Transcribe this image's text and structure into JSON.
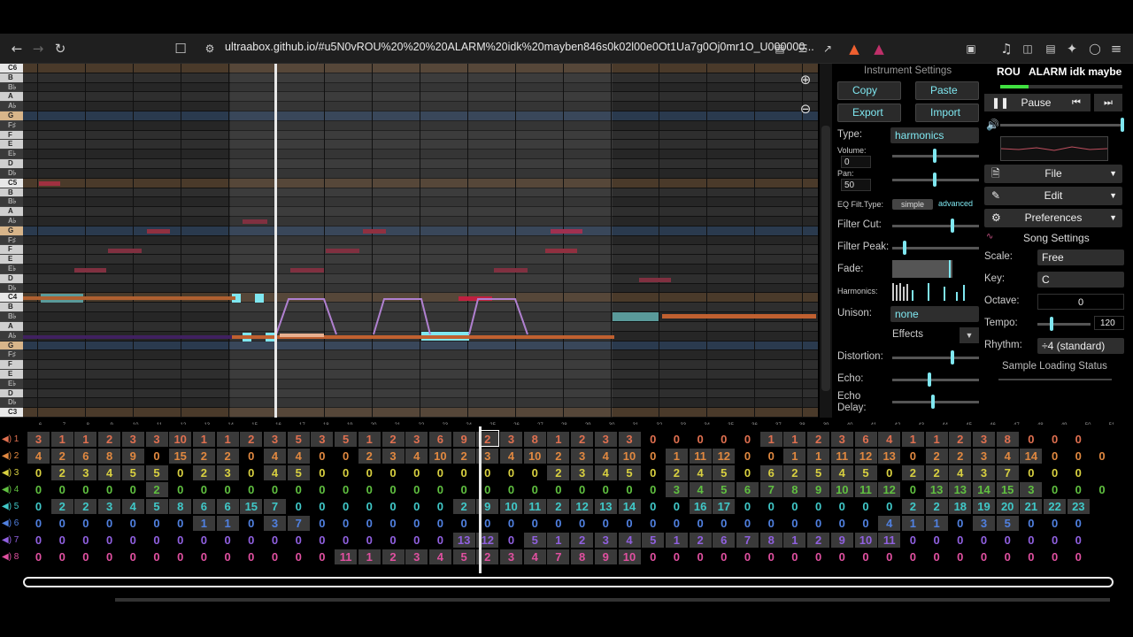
{
  "browser": {
    "url": "ultraabox.github.io/#u5N0vROU%20%20%20ALARM%20idk%20mayben846s0k02l00e0Ot1Ua7g0Oj0mr1O_U000000..."
  },
  "piano_keys": [
    "C6",
    "B",
    "B♭",
    "A",
    "A♭",
    "G",
    "F♯",
    "F",
    "E",
    "E♭",
    "D",
    "D♭",
    "C5",
    "B",
    "B♭",
    "A",
    "A♭",
    "G",
    "F♯",
    "F",
    "E",
    "E♭",
    "D",
    "D♭",
    "C4",
    "B",
    "B♭",
    "A",
    "A♭",
    "G",
    "F♯",
    "F",
    "E",
    "E♭",
    "D",
    "D♭",
    "C3"
  ],
  "instrument": {
    "header": "Instrument Settings",
    "copy": "Copy",
    "paste": "Paste",
    "export": "Export",
    "import": "Import",
    "type_label": "Type:",
    "type_value": "harmonics",
    "volume_label": "Volume:",
    "volume_value": "0",
    "pan_label": "Pan:",
    "pan_value": "50",
    "eq_label": "EQ Filt.Type:",
    "eq_simple": "simple",
    "eq_advanced": "advanced",
    "filter_cut": "Filter Cut:",
    "filter_peak": "Filter Peak:",
    "fade": "Fade:",
    "harmonics": "Harmonics:",
    "unison_label": "Unison:",
    "unison_value": "none",
    "effects": "Effects",
    "distortion": "Distortion:",
    "echo": "Echo:",
    "echo_delay": "Echo Delay:"
  },
  "song": {
    "title_prefix": "ROU",
    "title": "ALARM idk maybe",
    "pause": "Pause",
    "file": "File",
    "edit": "Edit",
    "preferences": "Preferences",
    "song_settings": "Song Settings",
    "scale_label": "Scale:",
    "scale_value": "Free",
    "key_label": "Key:",
    "key_value": "C",
    "octave_label": "Octave:",
    "octave_value": "0",
    "tempo_label": "Tempo:",
    "tempo_value": "120",
    "rhythm_label": "Rhythm:",
    "rhythm_value": "÷4 (standard)",
    "sample_status": "Sample Loading Status"
  },
  "channels": [
    {
      "label": "1",
      "color": "#e07050",
      "values": [
        "3",
        "1",
        "1",
        "2",
        "3",
        "3",
        "10",
        "1",
        "1",
        "2",
        "3",
        "5",
        "3",
        "5",
        "1",
        "2",
        "3",
        "6",
        "9",
        "2",
        "3",
        "8",
        "1",
        "2",
        "3",
        "3",
        "0",
        "0",
        "0",
        "0",
        "0",
        "1",
        "1",
        "2",
        "3",
        "6",
        "4",
        "1",
        "1",
        "2",
        "3",
        "8",
        "0",
        "0",
        "0"
      ]
    },
    {
      "label": "2",
      "color": "#e08840",
      "values": [
        "4",
        "2",
        "6",
        "8",
        "9",
        "0",
        "15",
        "2",
        "2",
        "0",
        "4",
        "4",
        "0",
        "0",
        "2",
        "3",
        "4",
        "10",
        "2",
        "3",
        "4",
        "10",
        "2",
        "3",
        "4",
        "10",
        "0",
        "1",
        "11",
        "12",
        "0",
        "0",
        "1",
        "1",
        "11",
        "12",
        "13",
        "0",
        "2",
        "2",
        "3",
        "4",
        "14",
        "0",
        "0",
        "0"
      ]
    },
    {
      "label": "3",
      "color": "#d8d040",
      "values": [
        "0",
        "2",
        "3",
        "4",
        "5",
        "5",
        "0",
        "2",
        "3",
        "0",
        "4",
        "5",
        "0",
        "0",
        "0",
        "0",
        "0",
        "0",
        "0",
        "0",
        "0",
        "0",
        "2",
        "3",
        "4",
        "5",
        "0",
        "2",
        "4",
        "5",
        "0",
        "6",
        "2",
        "5",
        "4",
        "5",
        "0",
        "2",
        "2",
        "4",
        "3",
        "7",
        "0",
        "0",
        "0"
      ]
    },
    {
      "label": "4",
      "color": "#60c040",
      "values": [
        "0",
        "0",
        "0",
        "0",
        "0",
        "2",
        "0",
        "0",
        "0",
        "0",
        "0",
        "0",
        "0",
        "0",
        "0",
        "0",
        "0",
        "0",
        "0",
        "0",
        "0",
        "0",
        "0",
        "0",
        "0",
        "0",
        "0",
        "3",
        "4",
        "5",
        "6",
        "7",
        "8",
        "9",
        "10",
        "11",
        "12",
        "0",
        "13",
        "13",
        "14",
        "15",
        "3",
        "0",
        "0",
        "0"
      ]
    },
    {
      "label": "5",
      "color": "#40c8c8",
      "values": [
        "0",
        "2",
        "2",
        "3",
        "4",
        "5",
        "8",
        "6",
        "6",
        "15",
        "7",
        "0",
        "0",
        "0",
        "0",
        "0",
        "0",
        "0",
        "2",
        "9",
        "10",
        "11",
        "2",
        "12",
        "13",
        "14",
        "0",
        "0",
        "16",
        "17",
        "0",
        "0",
        "0",
        "0",
        "0",
        "0",
        "0",
        "2",
        "2",
        "18",
        "19",
        "20",
        "21",
        "22",
        "23"
      ]
    },
    {
      "label": "6",
      "color": "#5080e0",
      "values": [
        "0",
        "0",
        "0",
        "0",
        "0",
        "0",
        "0",
        "1",
        "1",
        "0",
        "3",
        "7",
        "0",
        "0",
        "0",
        "0",
        "0",
        "0",
        "0",
        "0",
        "0",
        "0",
        "0",
        "0",
        "0",
        "0",
        "0",
        "0",
        "0",
        "0",
        "0",
        "0",
        "0",
        "0",
        "0",
        "0",
        "4",
        "1",
        "1",
        "0",
        "3",
        "5",
        "0",
        "0",
        "0"
      ]
    },
    {
      "label": "7",
      "color": "#9060e0",
      "values": [
        "0",
        "0",
        "0",
        "0",
        "0",
        "0",
        "0",
        "0",
        "0",
        "0",
        "0",
        "0",
        "0",
        "0",
        "0",
        "0",
        "0",
        "0",
        "13",
        "12",
        "0",
        "5",
        "1",
        "2",
        "3",
        "4",
        "5",
        "1",
        "2",
        "6",
        "7",
        "8",
        "1",
        "2",
        "9",
        "10",
        "11",
        "0",
        "0",
        "0",
        "0",
        "0",
        "0",
        "0",
        "0"
      ]
    },
    {
      "label": "8",
      "color": "#e050a0",
      "values": [
        "0",
        "0",
        "0",
        "0",
        "0",
        "0",
        "0",
        "0",
        "0",
        "0",
        "0",
        "0",
        "0",
        "11",
        "1",
        "2",
        "3",
        "4",
        "5",
        "2",
        "3",
        "4",
        "7",
        "8",
        "9",
        "10",
        "0",
        "0",
        "0",
        "0",
        "0",
        "0",
        "0",
        "0",
        "0",
        "0",
        "0",
        "0",
        "0",
        "0",
        "0",
        "0",
        "0",
        "0",
        "0"
      ]
    }
  ],
  "ruler": [
    "6",
    "7",
    "8",
    "9",
    "10",
    "11",
    "12",
    "13",
    "14",
    "15",
    "16",
    "17",
    "18",
    "19",
    "20",
    "21",
    "22",
    "23",
    "24",
    "25",
    "26",
    "27",
    "28",
    "29",
    "30",
    "31",
    "32",
    "33",
    "34",
    "35",
    "36",
    "37",
    "38",
    "39",
    "40",
    "41",
    "42",
    "43",
    "44",
    "45",
    "46",
    "47",
    "48",
    "49",
    "50",
    "51"
  ]
}
